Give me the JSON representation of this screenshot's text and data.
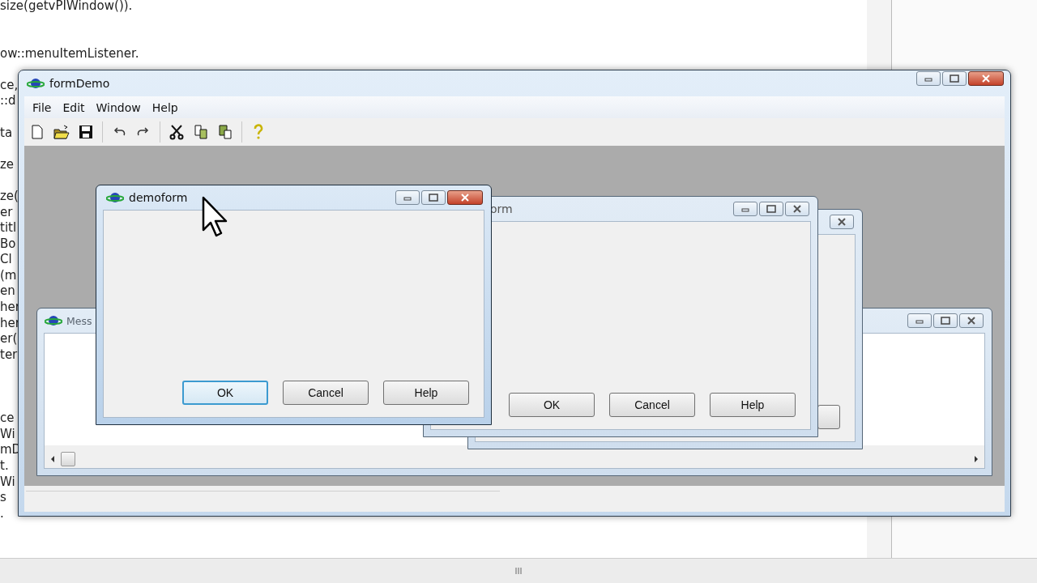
{
  "editor": {
    "lines": [
      {
        "text": "size(getvPIWindow())."
      },
      {
        "text": "ow::menuItemListener."
      },
      {
        "text": "ce,"
      },
      {
        "text": "::d"
      },
      {
        "text": "ta"
      },
      {
        "text": "ze"
      },
      {
        "text": "ze("
      },
      {
        "text": "er"
      },
      {
        "text": "titl"
      },
      {
        "text": "Bo"
      },
      {
        "text": "Cl"
      },
      {
        "text": "(m"
      },
      {
        "text": "en"
      },
      {
        "text": "her"
      },
      {
        "text": "her"
      },
      {
        "text": "er("
      },
      {
        "text": "ter"
      },
      {
        "text": "ce"
      },
      {
        "text": "Wi"
      },
      {
        "text": "mD"
      },
      {
        "text": "t."
      },
      {
        "text": "Wi"
      },
      {
        "text": "s"
      },
      {
        "text": "."
      }
    ]
  },
  "main_window": {
    "title": "formDemo",
    "menu": [
      "File",
      "Edit",
      "Window",
      "Help"
    ],
    "toolbar": [
      {
        "kind": "new"
      },
      {
        "kind": "open"
      },
      {
        "kind": "save"
      },
      {
        "kind": "separator"
      },
      {
        "kind": "undo"
      },
      {
        "kind": "redo"
      },
      {
        "kind": "separator"
      },
      {
        "kind": "cut"
      },
      {
        "kind": "copy"
      },
      {
        "kind": "paste"
      },
      {
        "kind": "separator"
      },
      {
        "kind": "help"
      }
    ]
  },
  "child_windows": [
    {
      "kind": "scroll",
      "title": "Mess",
      "active": false
    },
    {
      "kind": "stub",
      "active": false
    },
    {
      "kind": "dialog",
      "title": "orm",
      "active": false,
      "buttons": [
        {
          "label": "OK",
          "focused": false
        },
        {
          "label": "Cancel",
          "focused": false
        },
        {
          "label": "Help",
          "focused": false
        }
      ]
    },
    {
      "kind": "dialog",
      "title": "demoform",
      "active": true,
      "buttons": [
        {
          "label": "OK",
          "focused": true
        },
        {
          "label": "Cancel",
          "focused": false
        },
        {
          "label": "Help",
          "focused": false
        }
      ]
    }
  ]
}
